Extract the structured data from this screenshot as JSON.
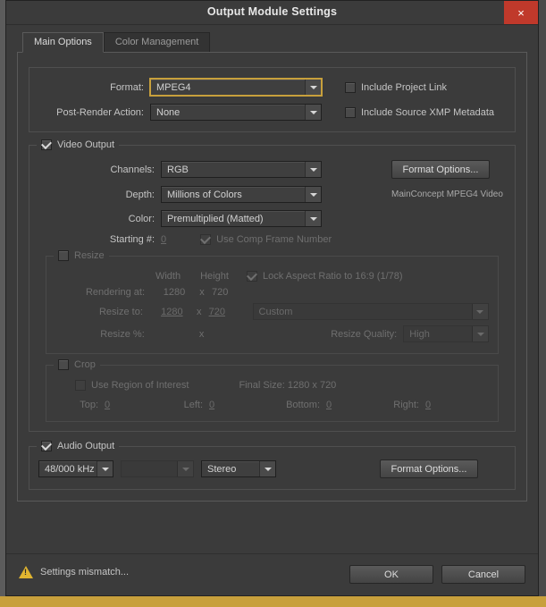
{
  "window": {
    "title": "Output Module Settings",
    "close_label": "×"
  },
  "tabs": [
    {
      "label": "Main Options",
      "active": true
    },
    {
      "label": "Color Management",
      "active": false
    }
  ],
  "format_section": {
    "format_label": "Format:",
    "format_value": "MPEG4",
    "post_render_label": "Post-Render Action:",
    "post_render_value": "None",
    "include_project_link_label": "Include Project Link",
    "include_project_link_checked": false,
    "include_xmp_label": "Include Source XMP Metadata",
    "include_xmp_checked": false
  },
  "video_output": {
    "legend": "Video Output",
    "checked": true,
    "channels_label": "Channels:",
    "channels_value": "RGB",
    "depth_label": "Depth:",
    "depth_value": "Millions of Colors",
    "color_label": "Color:",
    "color_value": "Premultiplied (Matted)",
    "starting_label": "Starting #:",
    "starting_value": "0",
    "use_comp_frame_label": "Use Comp Frame Number",
    "use_comp_frame_checked": true,
    "format_options_label": "Format Options...",
    "codec_note": "MainConcept MPEG4 Video"
  },
  "resize": {
    "legend": "Resize",
    "checked": false,
    "width_header": "Width",
    "height_header": "Height",
    "lock_aspect_label": "Lock Aspect Ratio to  16:9 (1/78)",
    "lock_aspect_checked": true,
    "rendering_at_label": "Rendering at:",
    "rendering_width": "1280",
    "rendering_x": "x",
    "rendering_height": "720",
    "resize_to_label": "Resize to:",
    "resize_width": "1280",
    "resize_x": "x",
    "resize_height": "720",
    "preset_value": "Custom",
    "resize_pct_label": "Resize %:",
    "resize_pct_x": "x",
    "resize_quality_label": "Resize Quality:",
    "resize_quality_value": "High"
  },
  "crop": {
    "legend": "Crop",
    "checked": false,
    "use_roi_label": "Use Region of Interest",
    "use_roi_checked": false,
    "final_size_label": "Final Size: 1280 x 720",
    "top_label": "Top:",
    "top_value": "0",
    "left_label": "Left:",
    "left_value": "0",
    "bottom_label": "Bottom:",
    "bottom_value": "0",
    "right_label": "Right:",
    "right_value": "0"
  },
  "audio_output": {
    "legend": "Audio Output",
    "checked": true,
    "sample_rate_value": "48/000 kHz",
    "bit_depth_value": "",
    "channels_value": "Stereo",
    "format_options_label": "Format Options..."
  },
  "footer": {
    "status_text": "Settings mismatch...",
    "warning_icon": "warning-triangle-icon",
    "ok_label": "OK",
    "cancel_label": "Cancel"
  }
}
